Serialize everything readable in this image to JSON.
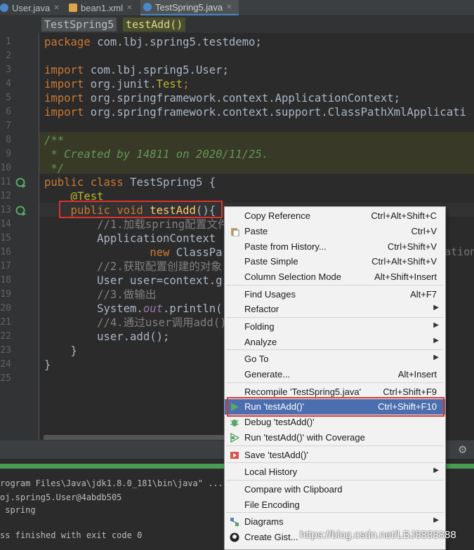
{
  "tabs": [
    {
      "label": "User.java",
      "icon": "java-class-icon",
      "active": false
    },
    {
      "label": "bean1.xml",
      "icon": "xml-file-icon",
      "active": false
    },
    {
      "label": "TestSpring5.java",
      "icon": "test-class-icon",
      "active": true
    }
  ],
  "breadcrumb": {
    "class_name": "TestSpring5",
    "method_name": "testAdd()"
  },
  "line_numbers": [
    "1",
    "2",
    "3",
    "4",
    "5",
    "6",
    "7",
    "8",
    "9",
    "10",
    "11",
    "12",
    "13",
    "14",
    "15",
    "16",
    "17",
    "18",
    "19",
    "20",
    "21",
    "22",
    "23",
    "24",
    "25"
  ],
  "code": {
    "l1a": "package",
    "l1b": " com.lbj.spring5.testdemo;",
    "l3a": "import",
    "l3b": " com.lbj.spring5.User;",
    "l4a": "import",
    "l4b": " org.junit.",
    "l4c": "Test",
    "l4d": ";",
    "l5a": "import",
    "l5b": " org.springframework.context.ApplicationContext;",
    "l6a": "import",
    "l6b": " org.springframework.context.support.ClassPathXmlApplicati",
    "l8": "/**",
    "l9": " * Created by 14811 on 2020/11/25.",
    "l10": " */",
    "l11a": "public class",
    "l11b": " TestSpring5 {",
    "l12": "    @Test",
    "l13a": "    public void ",
    "l13b": "testAdd",
    "l13c": "(){",
    "l14": "        //1.加载spring配置文件",
    "l15": "        ApplicationContext ",
    "l16a": "                new ",
    "l16b": "ClassPa",
    "l17": "        //2.获取配置创建的对象",
    "l18": "        User user=context.g",
    "l19": "        //3.做输出",
    "l20a": "        System.",
    "l20b": "out",
    "l20c": ".println(",
    "l21": "        //4.通过user调用add()",
    "l22": "        user.add();",
    "l23": "    }",
    "l24": "}"
  },
  "side_text": "ation:",
  "output": {
    "line1": "rogram Files\\Java\\jdk1.8.0_181\\bin\\java\" ...",
    "line2": "oj.spring5.User@4abdb505",
    "line3": " spring",
    "line4": "ss finished with exit code 0"
  },
  "menu": [
    {
      "label": "Copy Reference",
      "shortcut": "Ctrl+Alt+Shift+C",
      "icon": ""
    },
    {
      "label": "Paste",
      "shortcut": "Ctrl+V",
      "icon": "paste-icon"
    },
    {
      "label": "Paste from History...",
      "shortcut": "Ctrl+Shift+V",
      "icon": ""
    },
    {
      "label": "Paste Simple",
      "shortcut": "Ctrl+Alt+Shift+V",
      "icon": ""
    },
    {
      "label": "Column Selection Mode",
      "shortcut": "Alt+Shift+Insert",
      "icon": ""
    },
    {
      "label": "Find Usages",
      "shortcut": "Alt+F7",
      "icon": ""
    },
    {
      "label": "Refactor",
      "shortcut": "",
      "icon": ""
    },
    {
      "label": "Folding",
      "shortcut": "",
      "icon": ""
    },
    {
      "label": "Analyze",
      "shortcut": "",
      "icon": ""
    },
    {
      "label": "Go To",
      "shortcut": "",
      "icon": ""
    },
    {
      "label": "Generate...",
      "shortcut": "Alt+Insert",
      "icon": ""
    },
    {
      "label": "Recompile 'TestSpring5.java'",
      "shortcut": "Ctrl+Shift+F9",
      "icon": ""
    },
    {
      "label": "Run 'testAdd()'",
      "shortcut": "Ctrl+Shift+F10",
      "icon": "run-icon"
    },
    {
      "label": "Debug 'testAdd()'",
      "shortcut": "",
      "icon": "debug-icon"
    },
    {
      "label": "Run 'testAdd()' with Coverage",
      "shortcut": "",
      "icon": "coverage-icon"
    },
    {
      "label": "Save 'testAdd()'",
      "shortcut": "",
      "icon": "save-config-icon"
    },
    {
      "label": "Local History",
      "shortcut": "",
      "icon": ""
    },
    {
      "label": "Compare with Clipboard",
      "shortcut": "",
      "icon": ""
    },
    {
      "label": "File Encoding",
      "shortcut": "",
      "icon": ""
    },
    {
      "label": "Diagrams",
      "shortcut": "",
      "icon": "diagrams-icon"
    },
    {
      "label": "Create Gist...",
      "shortcut": "",
      "icon": "github-icon"
    }
  ],
  "watermark": "https://blog.csdn.net/LBJ8888888",
  "colors": {
    "accent": "#4b6eaf",
    "highlight_border": "#e0332e",
    "progress": "#499c54"
  }
}
